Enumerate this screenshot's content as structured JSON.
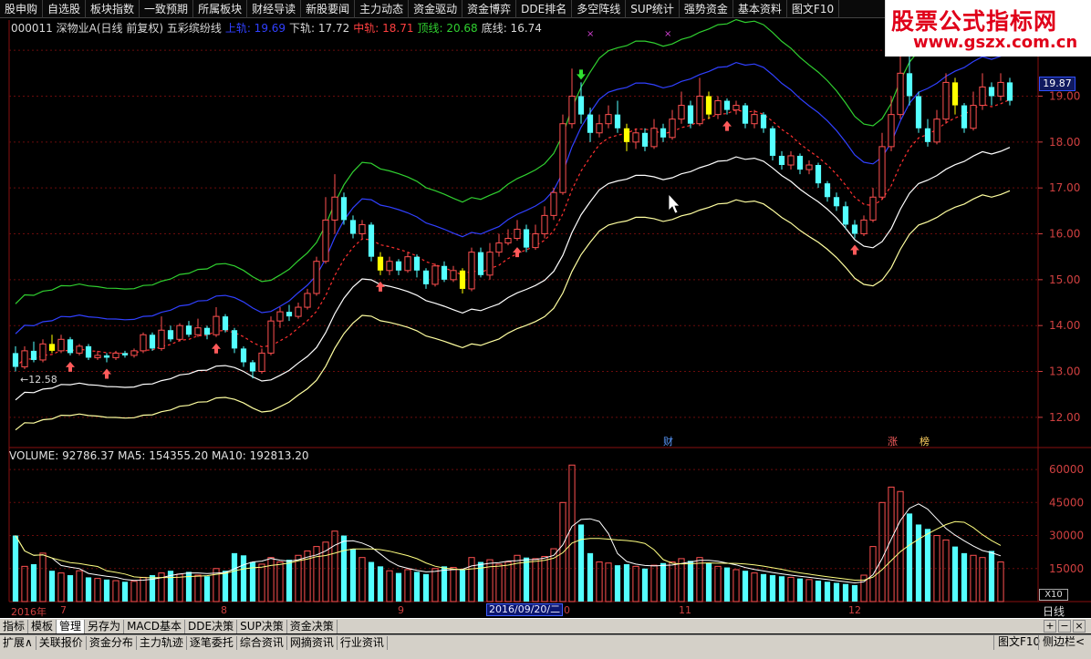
{
  "menu": [
    "股申购",
    "自选股",
    "板块指数",
    "一致预期",
    "所属板块",
    "财经导读",
    "新股要闻",
    "主力动态",
    "资金驱动",
    "资金博弈",
    "DDE排名",
    "多空阵线",
    "SUP统计",
    "强势资金",
    "基本资料",
    "图文F10"
  ],
  "logo": {
    "line1": "股票公式指标网",
    "line2": "www.gszx.com.cn"
  },
  "header": {
    "stock": "000011 深物业A(日线 前复权) 五彩缤纷线",
    "upper_label": "上轨: 19.69",
    "lower_label": "下轨: 17.72",
    "mid_label": "中轨: 18.71",
    "top_label": "顶线: 20.68",
    "bottom_label": "底线: 16.74"
  },
  "colors": {
    "up": "#ff5050",
    "down": "#54ffff",
    "yellow": "#ffff00",
    "upper": "#3040ff",
    "top": "#30d030",
    "bottom": "#ffffa0",
    "mid": "#ff3030"
  },
  "price_axis": [
    "20.00",
    "19.00",
    "18.00",
    "17.00",
    "16.00",
    "15.00",
    "14.00",
    "13.00",
    "12.00"
  ],
  "current_price": "19.87",
  "low_marker": "←12.58",
  "event_labels": {
    "cai": "财",
    "zhang": "涨",
    "bang": "榜"
  },
  "volume_header": "VOLUME: 92786.37  MA5: 154355.20  MA10: 192813.20",
  "volume_axis": [
    "60000",
    "45000",
    "30000",
    "15000"
  ],
  "volume_multiplier": "X10",
  "time_axis": {
    "year": "2016年",
    "m7": "7",
    "m8": "8",
    "m9": "9",
    "selected_date": "2016/09/20/二",
    "m10": "0",
    "m11": "11",
    "m12": "12"
  },
  "period": "日线",
  "tool_tabs": [
    "指标",
    "模板",
    "管理",
    "另存为",
    "MACD基本",
    "DDE决策",
    "SUP决策",
    "资金决策"
  ],
  "info_tabs": [
    "扩展∧",
    "关联报价",
    "资金分布",
    "主力轨迹",
    "逐笔委托",
    "综合资讯",
    "网摘资讯",
    "行业资讯"
  ],
  "info_right": {
    "f10": "图文F10",
    "side": "侧边栏<"
  },
  "chart_data": {
    "type": "candlestick",
    "price_ylim": [
      11.6,
      20.5
    ],
    "volume_ylim": [
      0,
      65000
    ],
    "candles": [
      [
        13.4,
        13.1,
        13.55,
        13.0
      ],
      [
        13.1,
        13.45,
        13.55,
        13.05
      ],
      [
        13.45,
        13.25,
        13.65,
        13.2
      ],
      [
        13.25,
        13.6,
        13.7,
        13.2
      ],
      [
        13.6,
        13.45,
        13.8,
        13.4
      ],
      [
        13.45,
        13.7,
        13.8,
        13.4
      ],
      [
        13.7,
        13.4,
        13.75,
        13.35
      ],
      [
        13.4,
        13.55,
        13.6,
        13.35
      ],
      [
        13.55,
        13.3,
        13.6,
        13.25
      ],
      [
        13.3,
        13.35,
        13.45,
        13.25
      ],
      [
        13.35,
        13.3,
        13.4,
        13.2
      ],
      [
        13.3,
        13.4,
        13.45,
        13.25
      ],
      [
        13.4,
        13.35,
        13.45,
        13.3
      ],
      [
        13.35,
        13.45,
        13.5,
        13.3
      ],
      [
        13.45,
        13.8,
        13.85,
        13.4
      ],
      [
        13.8,
        13.5,
        13.85,
        13.45
      ],
      [
        13.5,
        13.9,
        14.2,
        13.45
      ],
      [
        13.9,
        13.7,
        14.0,
        13.65
      ],
      [
        13.7,
        14.0,
        14.05,
        13.65
      ],
      [
        14.0,
        13.8,
        14.1,
        13.75
      ],
      [
        13.8,
        13.95,
        14.15,
        13.75
      ],
      [
        13.95,
        13.8,
        14.0,
        13.7
      ],
      [
        13.8,
        14.2,
        14.4,
        13.75
      ],
      [
        14.2,
        13.9,
        14.25,
        13.85
      ],
      [
        13.9,
        13.5,
        13.95,
        13.4
      ],
      [
        13.5,
        13.2,
        13.55,
        13.1
      ],
      [
        13.2,
        13.0,
        13.25,
        12.85
      ],
      [
        13.0,
        13.4,
        13.5,
        12.95
      ],
      [
        13.4,
        14.1,
        14.2,
        13.35
      ],
      [
        14.1,
        14.3,
        14.4,
        13.95
      ],
      [
        14.3,
        14.2,
        14.45,
        14.1
      ],
      [
        14.2,
        14.4,
        14.5,
        14.15
      ],
      [
        14.4,
        14.7,
        14.8,
        14.35
      ],
      [
        14.7,
        15.4,
        15.5,
        14.65
      ],
      [
        15.4,
        16.3,
        16.8,
        15.35
      ],
      [
        16.3,
        16.8,
        17.3,
        16.0
      ],
      [
        16.8,
        16.3,
        16.9,
        16.2
      ],
      [
        16.3,
        16.0,
        16.4,
        15.9
      ],
      [
        16.0,
        16.2,
        16.3,
        15.9
      ],
      [
        16.2,
        15.5,
        16.25,
        15.4
      ],
      [
        15.5,
        15.2,
        15.6,
        15.1
      ],
      [
        15.2,
        15.4,
        15.5,
        15.1
      ],
      [
        15.4,
        15.2,
        15.45,
        15.1
      ],
      [
        15.2,
        15.5,
        15.6,
        15.15
      ],
      [
        15.5,
        15.2,
        15.55,
        15.05
      ],
      [
        15.2,
        14.9,
        15.25,
        14.8
      ],
      [
        14.9,
        15.3,
        15.35,
        14.85
      ],
      [
        15.3,
        15.0,
        15.4,
        14.95
      ],
      [
        15.0,
        15.2,
        15.3,
        14.95
      ],
      [
        15.2,
        14.8,
        15.25,
        14.7
      ],
      [
        14.8,
        15.6,
        15.7,
        14.75
      ],
      [
        15.6,
        15.1,
        15.7,
        15.05
      ],
      [
        15.1,
        15.6,
        15.8,
        15.0
      ],
      [
        15.6,
        15.8,
        16.0,
        15.5
      ],
      [
        15.8,
        15.9,
        16.1,
        15.75
      ],
      [
        15.9,
        16.1,
        16.3,
        15.85
      ],
      [
        16.1,
        15.7,
        16.2,
        15.6
      ],
      [
        15.7,
        16.0,
        16.2,
        15.65
      ],
      [
        16.0,
        16.4,
        16.6,
        15.9
      ],
      [
        16.4,
        16.9,
        17.0,
        16.3
      ],
      [
        16.9,
        18.4,
        18.6,
        16.85
      ],
      [
        18.4,
        19.0,
        19.6,
        18.3
      ],
      [
        19.0,
        18.6,
        19.3,
        18.4
      ],
      [
        18.6,
        18.2,
        18.75,
        18.0
      ],
      [
        18.2,
        18.4,
        18.6,
        18.1
      ],
      [
        18.4,
        18.6,
        18.8,
        18.3
      ],
      [
        18.6,
        18.3,
        18.9,
        18.2
      ],
      [
        18.3,
        18.0,
        18.4,
        17.8
      ],
      [
        18.0,
        18.2,
        18.3,
        17.85
      ],
      [
        18.2,
        17.9,
        18.3,
        17.8
      ],
      [
        17.9,
        18.3,
        18.5,
        17.85
      ],
      [
        18.3,
        18.1,
        18.4,
        18.0
      ],
      [
        18.1,
        18.5,
        18.7,
        18.05
      ],
      [
        18.5,
        18.8,
        19.1,
        18.4
      ],
      [
        18.8,
        18.4,
        18.9,
        18.3
      ],
      [
        18.4,
        19.0,
        19.4,
        18.35
      ],
      [
        19.0,
        18.6,
        19.1,
        18.5
      ],
      [
        18.6,
        18.9,
        19.0,
        18.5
      ],
      [
        18.9,
        18.7,
        18.95,
        18.6
      ],
      [
        18.7,
        18.8,
        18.9,
        18.6
      ],
      [
        18.8,
        18.4,
        18.85,
        18.3
      ],
      [
        18.4,
        18.6,
        18.7,
        18.3
      ],
      [
        18.6,
        18.3,
        18.65,
        18.2
      ],
      [
        18.3,
        17.7,
        18.35,
        17.6
      ],
      [
        17.7,
        17.5,
        17.8,
        17.4
      ],
      [
        17.5,
        17.7,
        17.8,
        17.4
      ],
      [
        17.7,
        17.4,
        17.75,
        17.3
      ],
      [
        17.4,
        17.5,
        17.6,
        17.3
      ],
      [
        17.5,
        17.1,
        17.55,
        17.0
      ],
      [
        17.1,
        16.8,
        17.15,
        16.7
      ],
      [
        16.8,
        16.6,
        16.9,
        16.5
      ],
      [
        16.6,
        16.2,
        16.7,
        16.1
      ],
      [
        16.2,
        16.0,
        16.3,
        15.9
      ],
      [
        16.0,
        16.3,
        16.4,
        15.95
      ],
      [
        16.3,
        16.8,
        17.0,
        16.25
      ],
      [
        16.8,
        17.9,
        18.2,
        16.75
      ],
      [
        17.9,
        18.6,
        19.0,
        17.8
      ],
      [
        18.6,
        19.5,
        20.6,
        18.5
      ],
      [
        19.5,
        19.0,
        19.9,
        18.8
      ],
      [
        19.0,
        18.3,
        19.1,
        18.2
      ],
      [
        18.3,
        18.0,
        18.5,
        17.9
      ],
      [
        18.0,
        18.5,
        18.7,
        17.95
      ],
      [
        18.5,
        19.3,
        19.5,
        18.4
      ],
      [
        19.3,
        18.8,
        19.4,
        18.6
      ],
      [
        18.8,
        18.3,
        18.85,
        18.2
      ],
      [
        18.3,
        18.8,
        19.1,
        18.25
      ],
      [
        18.8,
        19.2,
        19.5,
        18.7
      ],
      [
        19.2,
        19.0,
        19.3,
        18.8
      ],
      [
        19.0,
        19.3,
        19.5,
        18.9
      ],
      [
        19.3,
        18.9,
        19.4,
        18.8
      ]
    ],
    "volumes": [
      30000,
      16000,
      17000,
      22000,
      14000,
      13000,
      12000,
      14000,
      11000,
      10500,
      10000,
      9500,
      9000,
      9200,
      11000,
      12000,
      13000,
      14000,
      12500,
      13500,
      12000,
      11500,
      15000,
      14000,
      22000,
      21000,
      18000,
      17000,
      20000,
      18000,
      19000,
      21000,
      23000,
      25000,
      27000,
      32000,
      30000,
      24000,
      20000,
      18000,
      16000,
      14000,
      13000,
      14500,
      13500,
      12500,
      15000,
      16000,
      15500,
      14500,
      20000,
      18000,
      19000,
      17000,
      18000,
      21000,
      20000,
      19500,
      20500,
      24000,
      45000,
      62000,
      35000,
      22000,
      18000,
      17500,
      16500,
      17000,
      16000,
      15000,
      16500,
      17500,
      18000,
      19500,
      18500,
      20000,
      17500,
      16000,
      15500,
      14500,
      14000,
      13000,
      12500,
      12000,
      11500,
      11000,
      10500,
      10000,
      9500,
      9000,
      8500,
      8000,
      7500,
      12000,
      25000,
      45000,
      52000,
      50000,
      40000,
      35000,
      33000,
      30000,
      28000,
      25000,
      22000,
      21000,
      20000,
      23000,
      18000
    ],
    "price_axis_ticks": [
      20,
      19,
      18,
      17,
      16,
      15,
      14,
      13,
      12
    ],
    "volume_axis_ticks": [
      60000,
      45000,
      30000,
      15000
    ]
  }
}
